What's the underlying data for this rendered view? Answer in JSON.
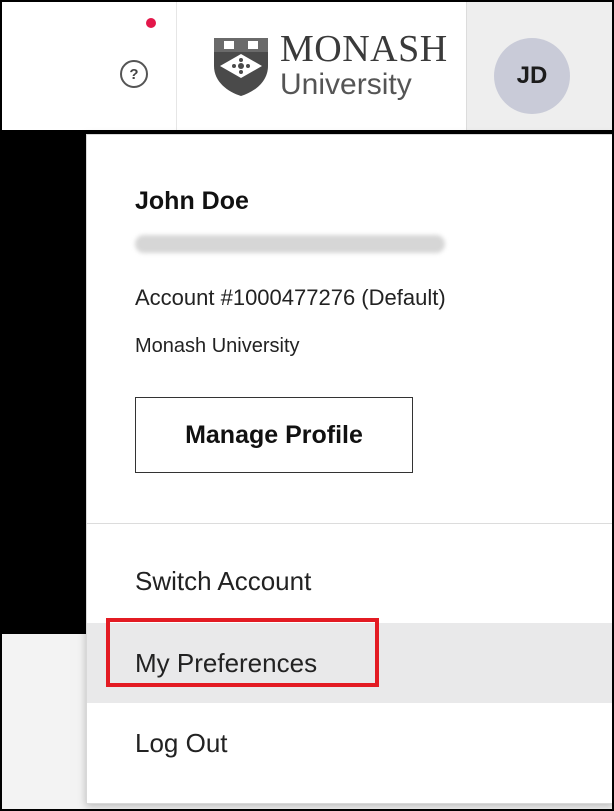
{
  "header": {
    "help_icon": "question-circle-icon",
    "help_glyph": "?",
    "notification_color": "#e3174a",
    "logo": {
      "line1": "MONASH",
      "line2": "University",
      "icon": "monash-shield-icon"
    },
    "avatar_initials": "JD",
    "avatar_color": "#c9cbd8"
  },
  "dropdown": {
    "user_name": "John Doe",
    "account": "Account #1000477276 (Default)",
    "organization": "Monash University",
    "manage_profile_label": "Manage Profile",
    "menu_items": [
      {
        "label": "Switch Account"
      },
      {
        "label": "My Preferences",
        "highlighted": true
      },
      {
        "label": "Log Out"
      }
    ],
    "highlight_color": "#e31b23"
  }
}
